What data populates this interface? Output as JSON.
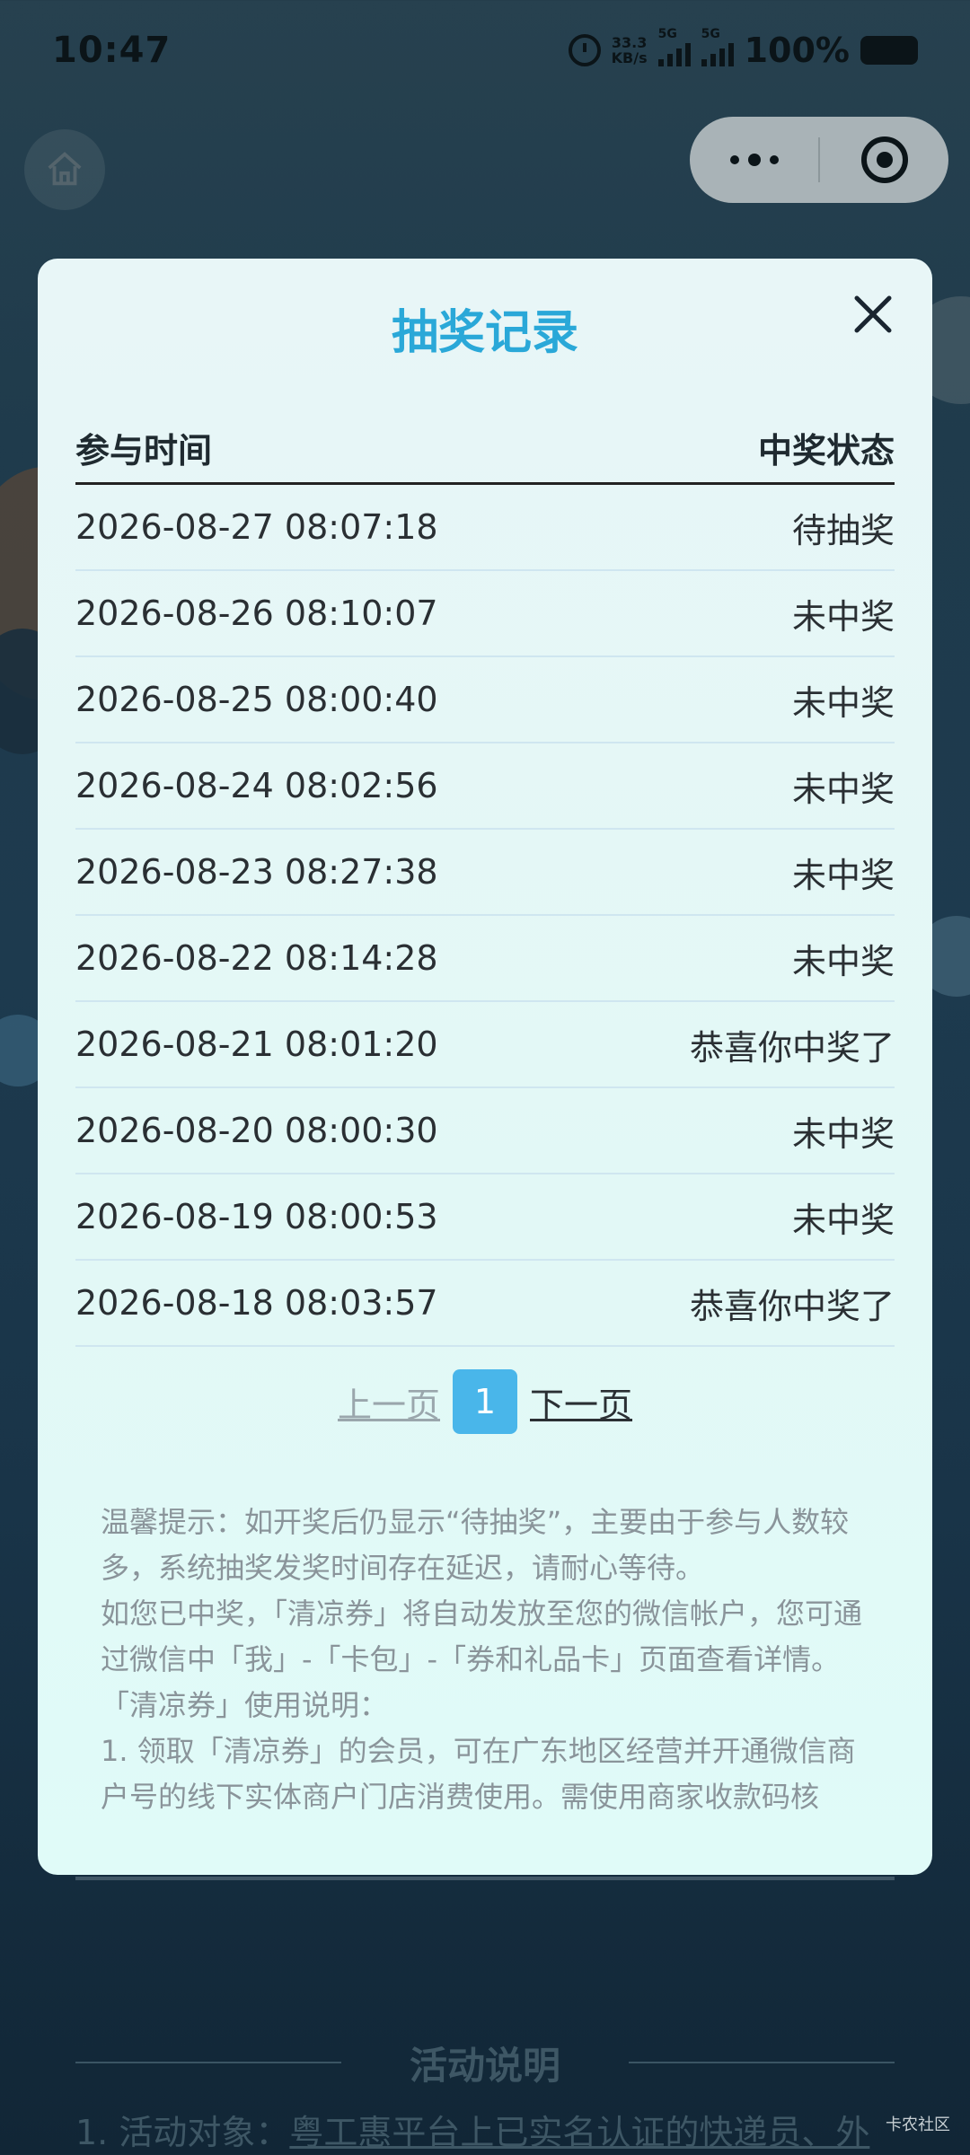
{
  "status_bar": {
    "time": "10:47",
    "net_speed_value": "33.3",
    "net_speed_unit": "KB/s",
    "signal1_label": "5G",
    "signal2_label": "5G",
    "battery": "100%"
  },
  "nav": {
    "home_icon": "home-icon",
    "more_icon": "more-dots-icon",
    "target_icon": "target-icon"
  },
  "modal": {
    "title": "抽奖记录",
    "close_icon": "close-icon",
    "header": {
      "time": "参与时间",
      "status": "中奖状态"
    },
    "rows": [
      {
        "time": "2026-08-27 08:07:18",
        "status": "待抽奖"
      },
      {
        "time": "2026-08-26 08:10:07",
        "status": "未中奖"
      },
      {
        "time": "2026-08-25 08:00:40",
        "status": "未中奖"
      },
      {
        "time": "2026-08-24 08:02:56",
        "status": "未中奖"
      },
      {
        "time": "2026-08-23 08:27:38",
        "status": "未中奖"
      },
      {
        "time": "2026-08-22 08:14:28",
        "status": "未中奖"
      },
      {
        "time": "2026-08-21 08:01:20",
        "status": "恭喜你中奖了"
      },
      {
        "time": "2026-08-20 08:00:30",
        "status": "未中奖"
      },
      {
        "time": "2026-08-19 08:00:53",
        "status": "未中奖"
      },
      {
        "time": "2026-08-18 08:03:57",
        "status": "恭喜你中奖了"
      }
    ],
    "pager": {
      "prev": "上一页",
      "current": "1",
      "next": "下一页"
    },
    "notes": [
      "温馨提示：如开奖后仍显示“待抽奖”，主要由于参与人数较多，系统抽奖发奖时间存在延迟，请耐心等待。",
      "如您已中奖，「清凉券」将自动发放至您的微信帐户，您可通过微信中「我」-「卡包」-「券和礼品卡」页面查看详情。",
      "「清凉券」使用说明：",
      "1. 领取「清凉券」的会员，可在广东地区经营并开通微信商户号的线下实体商户门店消费使用。需使用商家收款码核"
    ]
  },
  "background": {
    "section_title": "活动说明",
    "activity_prefix": "1. 活动对象：",
    "activity_link": "粤工惠平台上已实名认证的快递员、外",
    "watermark": "卡农社区"
  },
  "colors": {
    "accent": "#2aa8d8",
    "page_active": "#49b6ea",
    "modal_bg": "#e8f6f7"
  }
}
